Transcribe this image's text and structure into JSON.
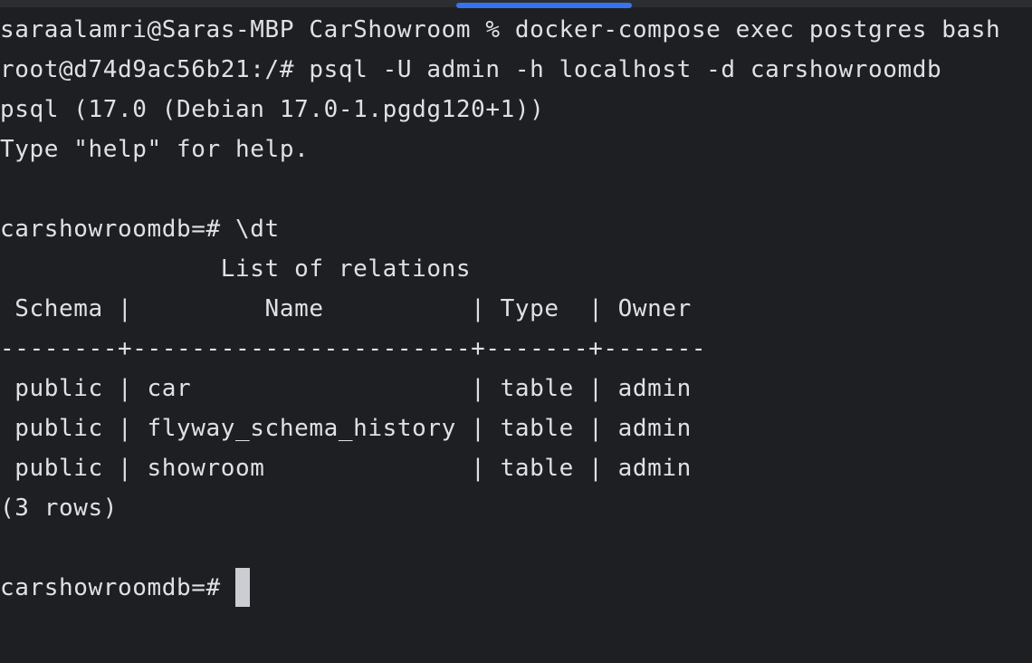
{
  "colors": {
    "background": "#1e1f22",
    "text": "#dfe1e5",
    "tab_indicator": "#3574f0",
    "cursor": "#cbcdd2"
  },
  "terminal": {
    "lines": [
      "saraalamri@Saras-MBP CarShowroom % docker-compose exec postgres bash",
      "root@d74d9ac56b21:/# psql -U admin -h localhost -d carshowroomdb",
      "psql (17.0 (Debian 17.0-1.pgdg120+1))",
      "Type \"help\" for help.",
      "",
      "carshowroomdb=# \\dt",
      "               List of relations",
      " Schema |         Name          | Type  | Owner",
      "--------+-----------------------+-------+-------",
      " public | car                   | table | admin",
      " public | flyway_schema_history | table | admin",
      " public | showroom              | table | admin",
      "(3 rows)",
      ""
    ],
    "prompt": "carshowroomdb=# "
  }
}
